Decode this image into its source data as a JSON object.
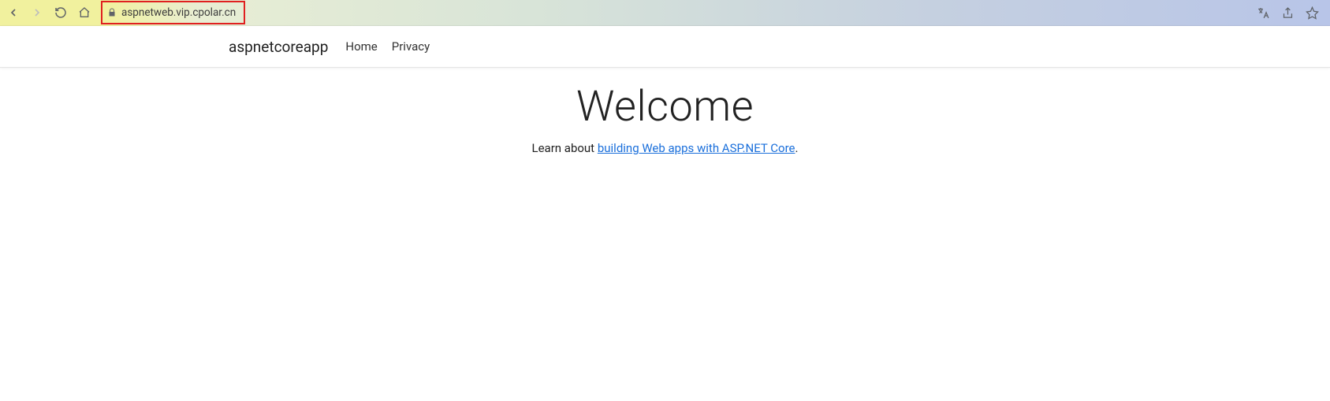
{
  "browser": {
    "url": "aspnetweb.vip.cpolar.cn"
  },
  "nav": {
    "brand": "aspnetcoreapp",
    "links": {
      "home": "Home",
      "privacy": "Privacy"
    }
  },
  "main": {
    "title": "Welcome",
    "subtitle_prefix": "Learn about ",
    "subtitle_link": "building Web apps with ASP.NET Core",
    "subtitle_suffix": "."
  }
}
